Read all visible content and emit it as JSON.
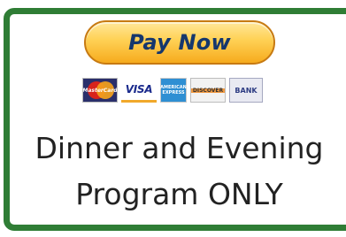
{
  "payment": {
    "button_label": "Pay Now",
    "cards": [
      {
        "name": "MasterCard",
        "icon": "mastercard-logo-icon",
        "label": "MasterCard"
      },
      {
        "name": "VISA",
        "icon": "visa-logo-icon",
        "label": "VISA"
      },
      {
        "name": "American Express",
        "icon": "amex-logo-icon",
        "label": "AMERICAN EXPRESS"
      },
      {
        "name": "Discover",
        "icon": "discover-logo-icon",
        "label": "DISCOVER"
      },
      {
        "name": "BANK",
        "icon": "bank-logo-icon",
        "label": "BANK"
      }
    ]
  },
  "program": {
    "line1": "Dinner and Evening",
    "line2": "Program ONLY"
  },
  "colors": {
    "border": "#2f7d35",
    "button_gold": "#ffd257",
    "button_text": "#15376d",
    "text": "#222222"
  }
}
